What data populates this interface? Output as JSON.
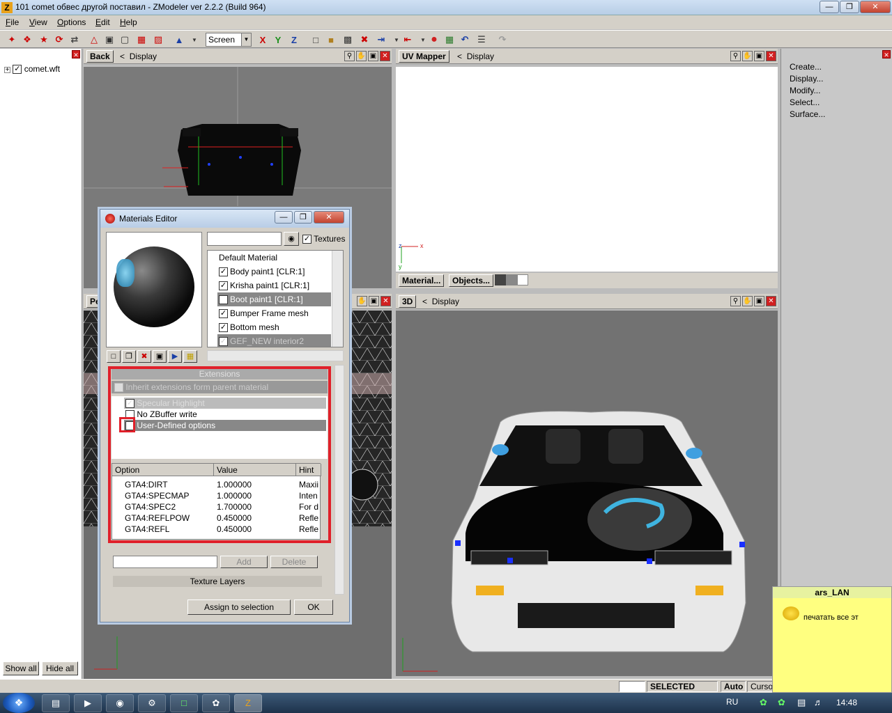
{
  "window": {
    "title": "101 comet обвес другой поставил - ZModeler ver 2.2.2 (Build 964)",
    "app_icon": "Z"
  },
  "menus": [
    "File",
    "View",
    "Options",
    "Edit",
    "Help"
  ],
  "toolbar": {
    "mode_select": "Screen",
    "axis_x": "X",
    "axis_y": "Y",
    "axis_z": "Z"
  },
  "tree": {
    "root": "comet.wft"
  },
  "left_buttons": {
    "show_all": "Show all",
    "hide_all": "Hide all"
  },
  "viewports": {
    "back": {
      "label": "Back",
      "display": "Display"
    },
    "uv": {
      "label": "UV Mapper",
      "display": "Display",
      "material_btn": "Material...",
      "objects_btn": "Objects...",
      "axis_x": "x",
      "axis_y": "y",
      "axis_z": "z"
    },
    "persp": {
      "label": "Pe"
    },
    "d3": {
      "label": "3D",
      "display": "Display"
    }
  },
  "right_menu": [
    "Create...",
    "Display...",
    "Modify...",
    "Select...",
    "Surface..."
  ],
  "materials_editor": {
    "title": "Materials Editor",
    "textures_label": "Textures",
    "list": [
      {
        "name": "Default Material",
        "checked": false
      },
      {
        "name": "Body paint1 [CLR:1]",
        "checked": true
      },
      {
        "name": "Krisha paint1 [CLR:1]",
        "checked": true
      },
      {
        "name": "Boot paint1 [CLR:1]",
        "checked": true,
        "selected": true
      },
      {
        "name": "Bumper Frame mesh",
        "checked": true
      },
      {
        "name": "Bottom mesh",
        "checked": true
      },
      {
        "name": "GEF_NEW interior2",
        "checked": true,
        "selected": true
      }
    ],
    "extensions_header": "Extensions",
    "inherit_label": "Inherit extensions form parent material",
    "ext_options": [
      {
        "name": "Specular Highlight",
        "checked": true,
        "style": "dim"
      },
      {
        "name": "No ZBuffer write",
        "checked": false,
        "style": ""
      },
      {
        "name": "User-Defined options",
        "checked": true,
        "style": "sel"
      }
    ],
    "table": {
      "headers": [
        "Option",
        "Value",
        "Hint"
      ],
      "rows": [
        [
          "GTA4:DIRT",
          "1.000000",
          "Maxii"
        ],
        [
          "GTA4:SPECMAP",
          "1.000000",
          "Inten"
        ],
        [
          "GTA4:SPEC2",
          "1.700000",
          "For d"
        ],
        [
          "GTA4:REFLPOW",
          "0.450000",
          "Refle"
        ],
        [
          "GTA4:REFL",
          "0.450000",
          "Refle"
        ]
      ]
    },
    "add_btn": "Add",
    "delete_btn": "Delete",
    "texture_layers": "Texture Layers",
    "assign_btn": "Assign to selection",
    "ok_btn": "OK"
  },
  "status": {
    "mode": "SELECTED MODE",
    "auto": "Auto",
    "cursor": "Cursor"
  },
  "chat": {
    "user": "ars_LAN",
    "message": "печатать все эт"
  },
  "taskbar": {
    "lang": "RU",
    "clock": "14:48"
  }
}
